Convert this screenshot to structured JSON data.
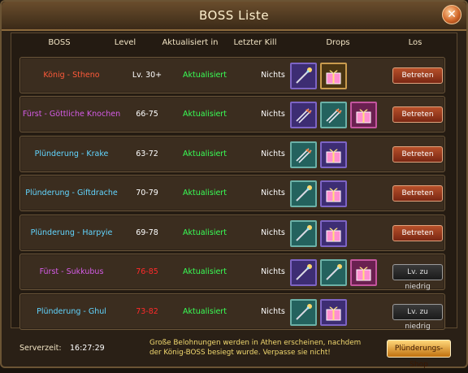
{
  "window": {
    "title": "BOSS Liste"
  },
  "headers": {
    "boss": "BOSS",
    "level": "Level",
    "updated": "Aktualisiert in",
    "last_kill": "Letzter Kill",
    "drops": "Drops",
    "action": "Los"
  },
  "colors": {
    "king_name": "#ff5a3a",
    "prince_name": "#d55ce7",
    "plunder_name": "#62d5ff",
    "updated": "#39ff56",
    "level_too_low": "#ff2a2a"
  },
  "rows": [
    {
      "name": "König - Stheno",
      "name_type": "king",
      "level": "Lv. 30+",
      "level_red": false,
      "updated": "Aktualisiert",
      "last_kill": "Nichts",
      "drops": [
        {
          "bg": "blue",
          "icon": "staff-icon"
        },
        {
          "bg": "gold",
          "icon": "gift-box-icon"
        }
      ],
      "button": "Betreten",
      "button_type": "enter"
    },
    {
      "name": "Fürst - Göttliche Knochen",
      "name_type": "prince",
      "level": "66-75",
      "level_red": false,
      "updated": "Aktualisiert",
      "last_kill": "Nichts",
      "drops": [
        {
          "bg": "blue",
          "icon": "arrows-icon"
        },
        {
          "bg": "green",
          "icon": "arrows-icon"
        },
        {
          "bg": "pink",
          "icon": "gift-box-icon"
        }
      ],
      "button": "Betreten",
      "button_type": "enter"
    },
    {
      "name": "Plünderung - Krake",
      "name_type": "plunder",
      "level": "63-72",
      "level_red": false,
      "updated": "Aktualisiert",
      "last_kill": "Nichts",
      "drops": [
        {
          "bg": "green",
          "icon": "arrows-icon"
        },
        {
          "bg": "blue",
          "icon": "gift-box-icon"
        }
      ],
      "button": "Betreten",
      "button_type": "enter"
    },
    {
      "name": "Plünderung - Giftdrache",
      "name_type": "plunder",
      "level": "70-79",
      "level_red": false,
      "updated": "Aktualisiert",
      "last_kill": "Nichts",
      "drops": [
        {
          "bg": "green",
          "icon": "staff-icon"
        },
        {
          "bg": "blue",
          "icon": "gift-box-icon"
        }
      ],
      "button": "Betreten",
      "button_type": "enter"
    },
    {
      "name": "Plünderung - Harpyie",
      "name_type": "plunder",
      "level": "69-78",
      "level_red": false,
      "updated": "Aktualisiert",
      "last_kill": "Nichts",
      "drops": [
        {
          "bg": "green",
          "icon": "staff-icon"
        },
        {
          "bg": "blue",
          "icon": "gift-box-icon"
        }
      ],
      "button": "Betreten",
      "button_type": "enter"
    },
    {
      "name": "Fürst - Sukkubus",
      "name_type": "prince",
      "level": "76-85",
      "level_red": true,
      "updated": "Aktualisiert",
      "last_kill": "Nichts",
      "drops": [
        {
          "bg": "blue",
          "icon": "staff-icon"
        },
        {
          "bg": "green",
          "icon": "staff-icon"
        },
        {
          "bg": "pink",
          "icon": "gift-box-icon"
        }
      ],
      "button": "Lv. zu niedrig",
      "button_type": "low"
    },
    {
      "name": "Plünderung - Ghul",
      "name_type": "plunder",
      "level": "73-82",
      "level_red": true,
      "updated": "Aktualisiert",
      "last_kill": "Nichts",
      "drops": [
        {
          "bg": "green",
          "icon": "staff-icon"
        },
        {
          "bg": "blue",
          "icon": "gift-box-icon"
        }
      ],
      "button": "Lv. zu niedrig",
      "button_type": "low"
    }
  ],
  "footer": {
    "server_label": "Serverzeit:",
    "server_time": "16:27:29",
    "notice": "Große Belohnungen werden in Athen erscheinen, nachdem der König-BOSS besiegt wurde. Verpasse sie nicht!",
    "shop_button": "Plünderungs-Shop"
  }
}
